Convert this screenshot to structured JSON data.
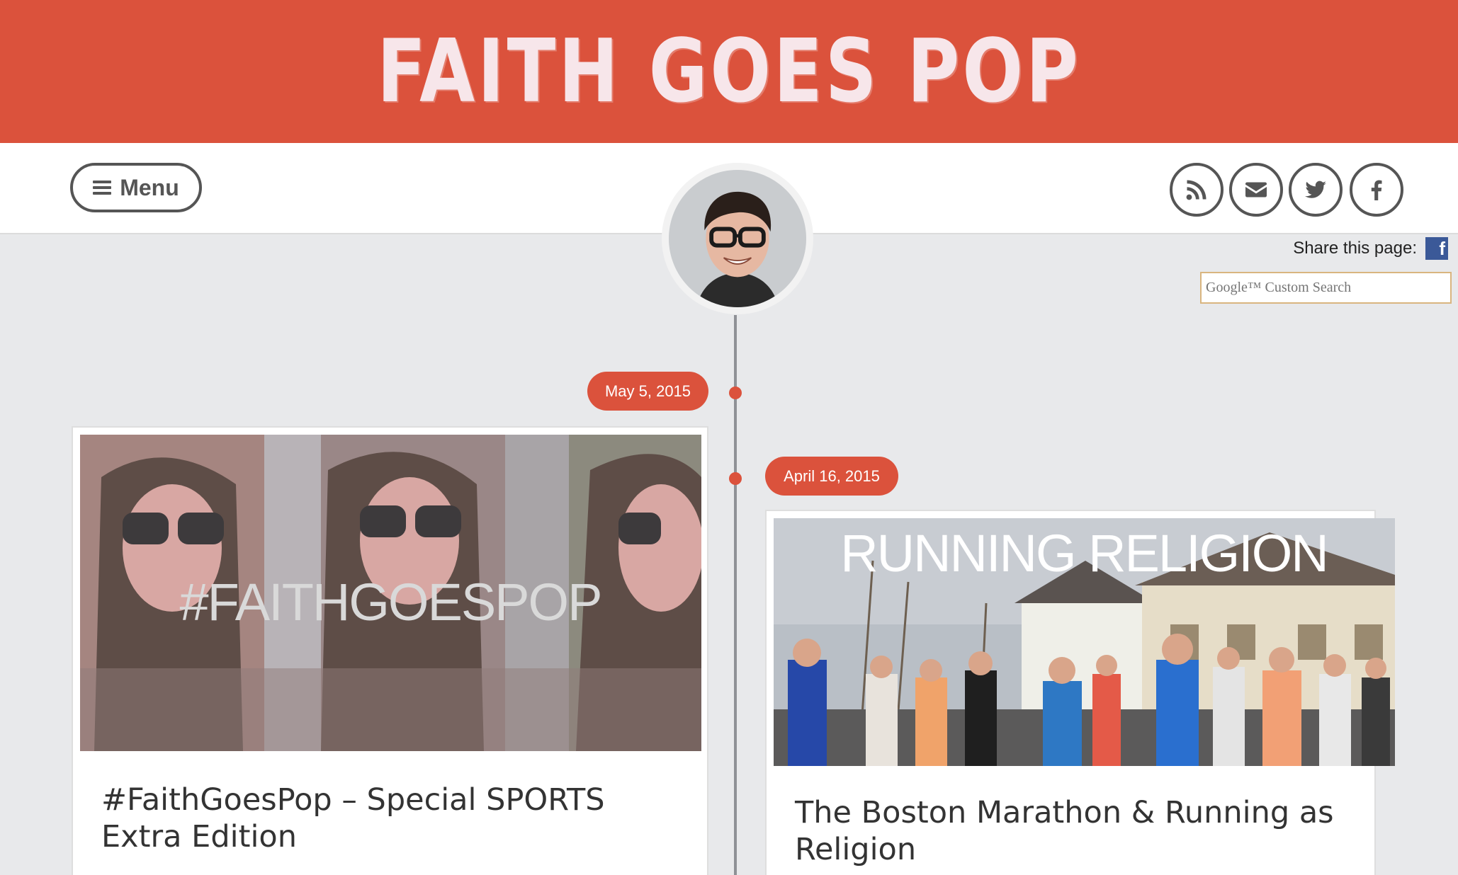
{
  "site": {
    "logo_text": "FAITH GOES POP",
    "brand_color": "#db523c"
  },
  "nav": {
    "menu_label": "Menu",
    "menu_icon": "hamburger-icon",
    "social": [
      {
        "name": "rss-icon"
      },
      {
        "name": "email-icon"
      },
      {
        "name": "twitter-icon"
      },
      {
        "name": "facebook-icon"
      }
    ]
  },
  "share": {
    "label": "Share this page:",
    "icon": "facebook-icon"
  },
  "search": {
    "placeholder": "Google™ Custom Search"
  },
  "timeline": {
    "posts": [
      {
        "date": "May 5, 2015",
        "image_text": "#FAITHGOESPOP",
        "title": "#FaithGoesPop – Special SPORTS Extra Edition"
      },
      {
        "date": "April 16, 2015",
        "image_text": "RUNNING RELIGION",
        "title": "The Boston Marathon & Running as Religion"
      }
    ]
  }
}
